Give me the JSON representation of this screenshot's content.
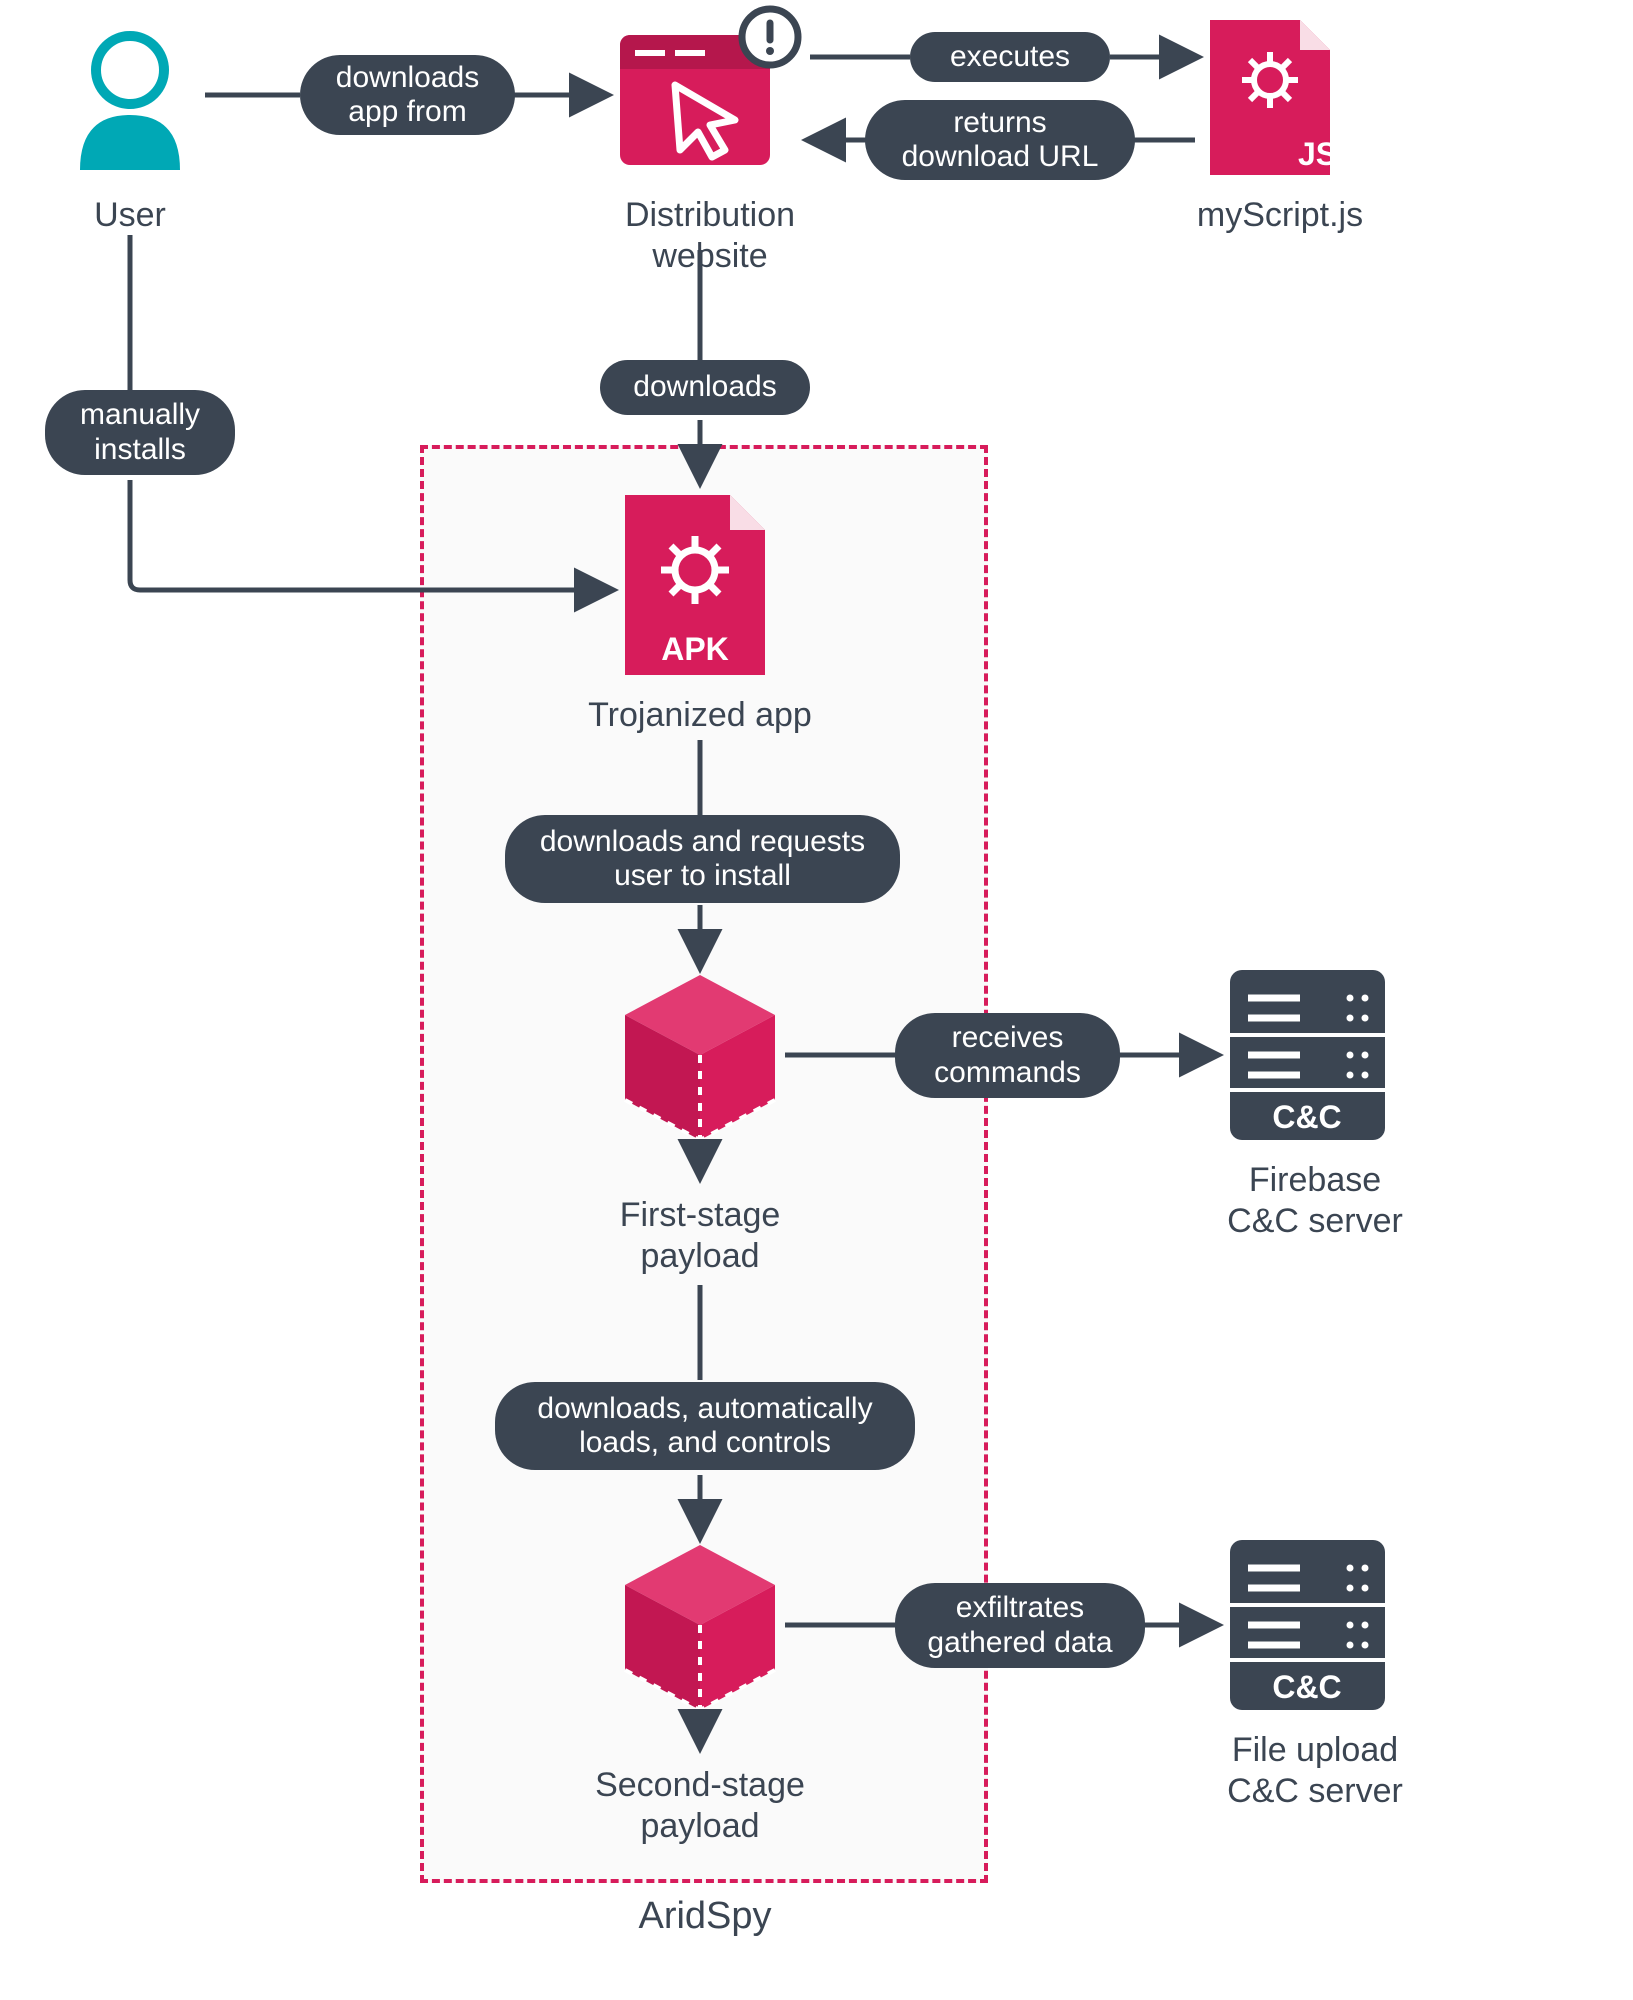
{
  "nodes": {
    "user": "User",
    "distribution_website": "Distribution\nwebsite",
    "myscript": "myScript.js",
    "trojanized_app": "Trojanized app",
    "first_stage_payload": "First-stage\npayload",
    "second_stage_payload": "Second-stage\npayload",
    "firebase_cc": "Firebase\nC&C server",
    "file_upload_cc": "File upload\nC&C server"
  },
  "edges": {
    "downloads_app_from": "downloads\napp from",
    "executes": "executes",
    "returns_download_url": "returns\ndownload URL",
    "manually_installs": "manually\ninstalls",
    "downloads": "downloads",
    "downloads_requests_install": "downloads and requests\nuser to install",
    "receives_commands": "receives\ncommands",
    "downloads_loads_controls": "downloads, automatically\nloads, and controls",
    "exfiltrates_data": "exfiltrates\ngathered data"
  },
  "group": {
    "aridspy": "AridSpy"
  },
  "file_labels": {
    "apk": "APK",
    "js": "JS",
    "cc": "C&C"
  }
}
